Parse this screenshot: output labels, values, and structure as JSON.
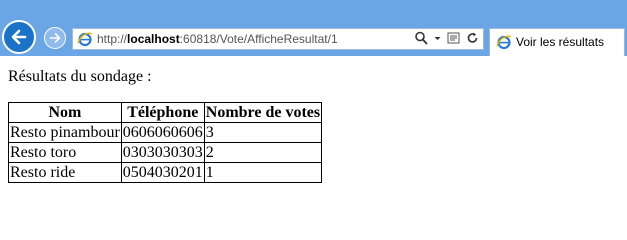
{
  "browser": {
    "url_prefix": "http://",
    "url_host": "localhost",
    "url_rest": ":60818/Vote/AfficheResultat/1",
    "tab_title": "Voir les résultats",
    "icons": {
      "back": "back-arrow-icon",
      "forward": "forward-arrow-icon",
      "site": "ie-icon",
      "search": "search-icon",
      "compat": "compatibility-icon",
      "refresh": "refresh-icon"
    },
    "colors": {
      "chrome": "#6aa5e6",
      "back_button": "#1b72c9"
    }
  },
  "page": {
    "heading": "Résultats du sondage :",
    "table": {
      "headers": [
        "Nom",
        "Téléphone",
        "Nombre de votes"
      ],
      "rows": [
        [
          "Resto pinambour",
          "0606060606",
          "3"
        ],
        [
          "Resto toro",
          "0303030303",
          "2"
        ],
        [
          "Resto ride",
          "0504030201",
          "1"
        ]
      ]
    }
  }
}
